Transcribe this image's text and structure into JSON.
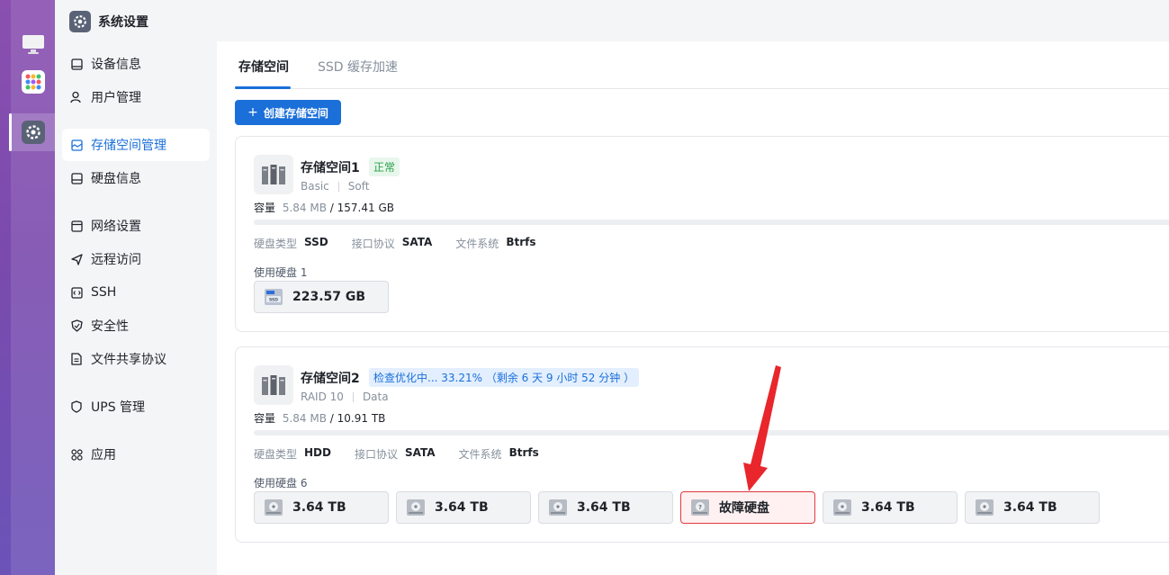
{
  "app": {
    "title": "系统设置"
  },
  "sidebar": {
    "items": [
      {
        "label": "设备信息",
        "icon": "device-icon"
      },
      {
        "label": "用户管理",
        "icon": "user-icon"
      },
      {
        "label": "存储空间管理",
        "icon": "storage-icon",
        "active": true
      },
      {
        "label": "硬盘信息",
        "icon": "disk-icon"
      },
      {
        "label": "网络设置",
        "icon": "network-icon"
      },
      {
        "label": "远程访问",
        "icon": "send-icon"
      },
      {
        "label": "SSH",
        "icon": "code-icon"
      },
      {
        "label": "安全性",
        "icon": "shield-icon"
      },
      {
        "label": "文件共享协议",
        "icon": "file-icon"
      },
      {
        "label": "UPS 管理",
        "icon": "ups-icon"
      },
      {
        "label": "应用",
        "icon": "apps-icon"
      }
    ]
  },
  "tabs": [
    {
      "label": "存储空间",
      "active": true
    },
    {
      "label": "SSD 缓存加速",
      "active": false
    }
  ],
  "create_button": {
    "label": "创建存储空间",
    "plus": "+"
  },
  "volumes": [
    {
      "name": "存储空间1",
      "status": "正常",
      "tags": [
        "Basic",
        "Soft"
      ],
      "capacity_label": "容量",
      "used": "5.84 MB",
      "total": "/ 157.41 GB",
      "usage_fraction": 0.0,
      "props": [
        {
          "label": "硬盘类型",
          "value": "SSD"
        },
        {
          "label": "接口协议",
          "value": "SATA"
        },
        {
          "label": "文件系统",
          "value": "Btrfs"
        }
      ],
      "disks_label": "使用硬盘 1",
      "disks": [
        {
          "label": "223.57 GB",
          "type": "ssd"
        }
      ]
    },
    {
      "name": "存储空间2",
      "status": "检查优化中... 33.21% （剩余 6 天 9 小时 52 分钟 ）",
      "tags": [
        "RAID 10",
        "Data"
      ],
      "capacity_label": "容量",
      "used": "5.84 MB",
      "total": "/ 10.91 TB",
      "usage_fraction": 0.0,
      "props": [
        {
          "label": "硬盘类型",
          "value": "HDD"
        },
        {
          "label": "接口协议",
          "value": "SATA"
        },
        {
          "label": "文件系统",
          "value": "Btrfs"
        }
      ],
      "disks_label": "使用硬盘 6",
      "disks": [
        {
          "label": "3.64 TB",
          "type": "hdd"
        },
        {
          "label": "3.64 TB",
          "type": "hdd"
        },
        {
          "label": "3.64 TB",
          "type": "hdd"
        },
        {
          "label": "故障硬盘",
          "type": "fault"
        },
        {
          "label": "3.64 TB",
          "type": "hdd"
        },
        {
          "label": "3.64 TB",
          "type": "hdd"
        }
      ]
    }
  ],
  "colors": {
    "accent": "#1a6fd9",
    "fault": "#e0393e",
    "arrow": "#e8262b"
  }
}
